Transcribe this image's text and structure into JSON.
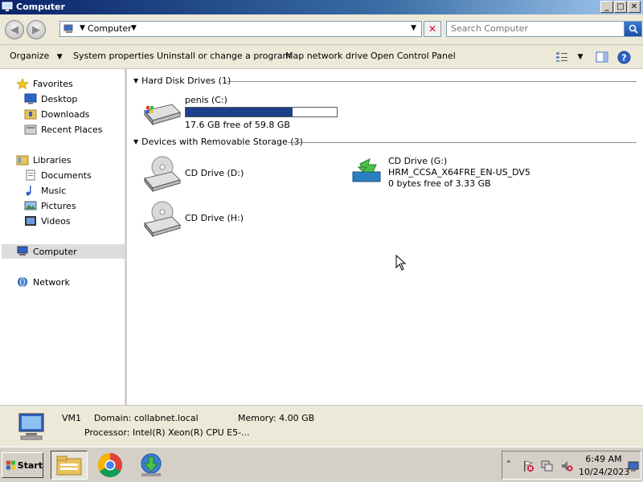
{
  "window": {
    "title": "Computer",
    "min_label": "_",
    "max_label": "□",
    "close_label": "✕"
  },
  "address": {
    "location": "Computer",
    "search_placeholder": "Search Computer",
    "icons": {
      "back": "back-arrow-icon",
      "forward": "forward-arrow-icon",
      "location": "computer-icon",
      "clear": "close-icon",
      "search": "search-icon"
    }
  },
  "toolbar": {
    "organize": "Organize",
    "system_properties": "System properties",
    "uninstall": "Uninstall or change a program",
    "map_network": "Map network drive",
    "control_panel": "Open Control Panel"
  },
  "nav": {
    "favorites": "Favorites",
    "desktop": "Desktop",
    "downloads": "Downloads",
    "recent": "Recent Places",
    "libraries": "Libraries",
    "documents": "Documents",
    "music": "Music",
    "pictures": "Pictures",
    "videos": "Videos",
    "computer": "Computer",
    "network": "Network"
  },
  "content": {
    "hdd_group": "Hard Disk Drives (1)",
    "removable_group": "Devices with Removable Storage (3)",
    "drive_c": {
      "name": "penis (C:)",
      "free": "17.6 GB free of 59.8 GB",
      "used_fraction": 0.706
    },
    "drive_d": {
      "name": "CD Drive (D:)"
    },
    "drive_g": {
      "name": "CD Drive (G:)",
      "label": "HRM_CCSA_X64FRE_EN-US_DV5",
      "free": "0 bytes free of 3.33 GB"
    },
    "drive_h": {
      "name": "CD Drive (H:)"
    }
  },
  "details": {
    "name": "VM1",
    "domain": "Domain: collabnet.local",
    "memory": "Memory: 4.00 GB",
    "processor": "Processor: Intel(R) Xeon(R) CPU E5-..."
  },
  "taskbar": {
    "start": "Start",
    "time": "6:49 AM",
    "date": "10/24/2023",
    "apps": [
      "explorer-icon",
      "chrome-icon",
      "internet-download-manager-icon"
    ]
  },
  "colors": {
    "titlebar": "#0a246a",
    "capacity_fill": "#1c3f8c",
    "chrome_face": "#ece9d8"
  }
}
